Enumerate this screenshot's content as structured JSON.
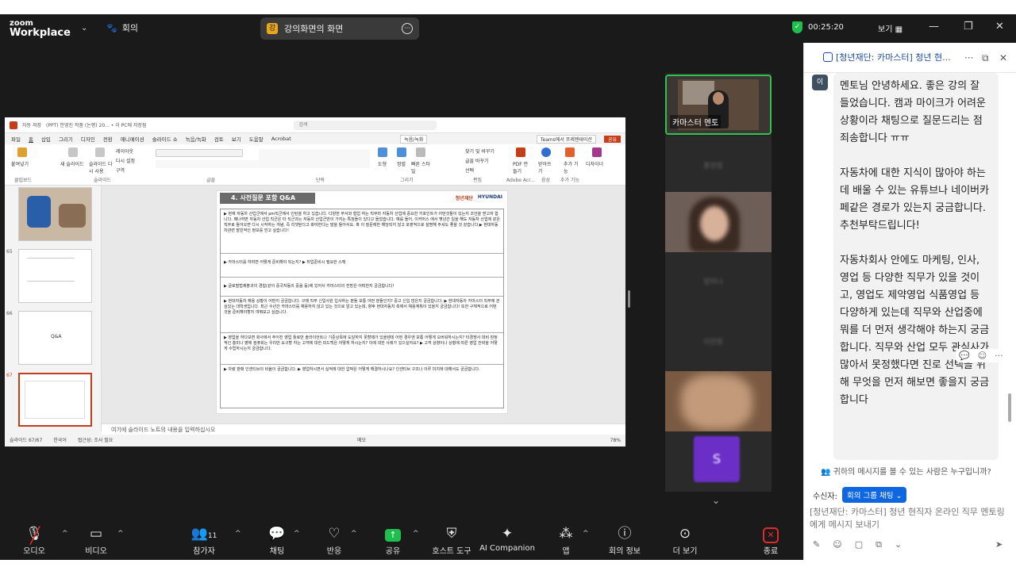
{
  "topbar": {
    "brand_top": "zoom",
    "brand_bottom": "Workplace",
    "meeting_label": "회의",
    "share_label": "강의화면의 화면",
    "timer": "00:25:20",
    "view_label": "보기"
  },
  "ppt": {
    "autosave": "자동 저장",
    "filename": "(PPT) 안영진 작품 (논평) 20... • 이 PC에 저장됨",
    "search_placeholder": "검색",
    "menu": [
      "파일",
      "홈",
      "삽입",
      "그리기",
      "디자인",
      "전환",
      "애니메이션",
      "슬라이드 쇼",
      "녹음/녹화",
      "검토",
      "보기",
      "도움말",
      "Acrobat"
    ],
    "record_btn": "녹음/녹화",
    "teams_btn": "Teams에서 프레젠테이션",
    "share_btn": "공유",
    "ribbon_groups": [
      "클립보드",
      "슬라이드",
      "글꼴",
      "단락",
      "그리기",
      "편집",
      "Adobe Acr...",
      "음성",
      "추가 기능"
    ],
    "ribbon_items": [
      "붙여넣기",
      "새 슬라이드",
      "슬라이드 다시 사용",
      "레이아웃",
      "다시 설정",
      "구역",
      "도형",
      "정렬",
      "빠른 스타일",
      "찾기 및 바꾸기",
      "글꼴 바꾸기",
      "선택",
      "PDF 만들기",
      "받아쓰기",
      "추가 기능",
      "디자이너"
    ],
    "thumb_numbers": [
      "65",
      "66",
      "67"
    ],
    "thumb_66_text": "Q&A",
    "slide_title": "4. 사전질문 포함 Q&A",
    "slide_logo1": "청년재단",
    "slide_logo2": "HYUNDAI",
    "slide_rows": [
      "▶ 현재 자동차 산업군에서 pm직군에서 인턴을 하고 있습니다. 다양한 부서와 협업 하는 직무라 자동차 산업에 중요한 키포인트가 어떤것들이 있는지 조언을 받고자 합니다. 패나하면 자동차 산업 직군은 타 직군과는 자동차 산업군만이 가지는 특징들이 있다고 들었습니다. 예를 들어, 이커머스 에서 몇년간 일을 해도 자동차 산업에 같은 직무로 들어오면 다시 시작하는 개념, 즉 리셋된다고 봐야한다는 말을 들어서요. 혹 이 질문에만 해당되지 않고 포괄적으로 설명해 주셔도 좋을 것 같습니다 ▶ 현대자동차관련 발빈적인 정보를 얻고 싶습니다!",
      "▶ 카마스터를 하려면 어떻게 준비해야 되는지? ▶ 취업준비시 필요한 스펙",
      "▶ 글로벌법제출과의 경험(같이 중국자동의 중음 등)에 있어서 카마스터의 전망은 어떠한지 궁금합니다!",
      "▶ 현대자동차 채용 상황이 어떤지 궁금합니다. 구매 직무 신입사원 입사하는 분들 보통 어떤 분들인지? 중고 신입 많은지 궁금합니다. ▶ 현대자동차 카마스터 직무에 관심있는 대학생입니다. 최근 수년간 카마스터를 채용하지 않고 있는 것으로 알고 있는데, 향후 현대자동차 측에서 채용계획이 있을지 궁금합니다! 또한 구체적으로 어떤 것을 준비해야할지 여쭤보고 싶습니다.",
      "▶ 영업을 하다보면 회사에서 주어진 영업 툴로만 솔라이언트나 기준상목에 도달하지 못할때가 있을텐데 어떤 경우엔 보통 어떻게 오버워하시는지? 타경쟁사 대비 판정적인 흥미나 뱉에 컴퓨회는 우리만 요구할 하는 고객에 대한 피드백은 어떻게 하시는지? 이에 대한 사례가 있으실까요? ▶ 고객 상향이나 상황에 따른 영업 전략을 어떻게 수립하시는지 궁금합니다.",
      "▶ 차량 판매 인센티브의 비율이 궁금합니다. ▶ 영업하시면서 실적에 대한 압박은 어떻게 해결하시나요? 인센티브 구조나 이루 미치에 대해서도 궁금합니다."
    ],
    "notes_placeholder": "여기에 슬라이드 노트의 내용을 입력하십시오",
    "status_slide": "슬라이드 67/67",
    "status_lang": "한국어",
    "status_access": "접근성: 조사 필요",
    "status_notes": "메모",
    "status_zoom": "78%"
  },
  "videos": {
    "main_name": "카마스터 멘토",
    "blur_names": [
      "홍연정",
      "정하나",
      "이연정"
    ],
    "s_avatar": "S"
  },
  "chat": {
    "title": "[청년재단: 카마스터] 청년 현...",
    "sender_initial": "이",
    "message_paragraphs": [
      "멘토님 안녕하세요. 좋은 강의 잘 들었습니다. 캠과 마이크가 어려운 상황이라 채팅으로 질문드리는 점 죄송합니다 ㅠㅠ",
      "자동차에 대한 지식이 많아야 하는데 배울 수 있는 유튜브나 네이버카페같은 경로가 있는지 궁금합니다. 추천부탁드립니다!",
      "자동차회사 안에도 마케팅, 인사, 영업 등 다양한 직무가 있을 것이고, 영업도 제약영업 식품영업 등 다양하게 있는데 직무와 산업중에 뭐를 더 먼저 생각해야 하는지 궁금합니다. 직무와 산업 모두 관심사가 많아서 못정했다면 진로 선택을 위해 무엇을 먼저 해보면 좋을지 궁금합니다"
    ],
    "who_can_see": "귀하의 메시지를 볼 수 있는 사람은 누구입니까?",
    "to_label": "수신자:",
    "to_value": "회의 그룹 채팅",
    "input_placeholder": "[청년재단: 카마스터] 청년 현직자 온라인 직무 멘토링에게 메시지 보내기"
  },
  "toolbar": {
    "audio": "오디오",
    "video": "비디오",
    "participants": "참가자",
    "participants_count": "11",
    "chat": "채팅",
    "reactions": "반응",
    "share": "공유",
    "host_tools": "호스트 도구",
    "ai_companion": "AI Companion",
    "apps": "앱",
    "meeting_info": "회의 정보",
    "more": "더 보기",
    "end": "종료"
  }
}
